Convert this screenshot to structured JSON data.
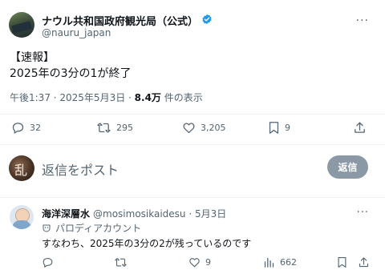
{
  "tweet": {
    "display_name": "ナウル共和国政府観光局（公式）",
    "handle": "@nauru_japan",
    "text_line1": "【速報】",
    "text_line2": "2025年の3分の1が終了",
    "time": "午後1:37 · 2025年5月3日 · ",
    "views": "8.4万",
    "views_suffix": " 件の表示",
    "actions": {
      "replies": "32",
      "retweets": "295",
      "likes": "3,205",
      "bookmarks": "9"
    }
  },
  "reply_box": {
    "placeholder": "返信をポスト",
    "button_label": "返信"
  },
  "comment": {
    "display_name": "海洋深層水",
    "handle": "@mosimosikaidesu · 5月3日",
    "label": "パロディアカウント",
    "text": "すなわち、2025年の3分の2が残っているのです",
    "actions": {
      "replies": "",
      "retweets": "",
      "likes": "9",
      "views": "662"
    }
  },
  "colors": {
    "verified_badge": "#1d9bf0",
    "secondary_text": "#536471",
    "reply_button": "#8b98a5"
  }
}
